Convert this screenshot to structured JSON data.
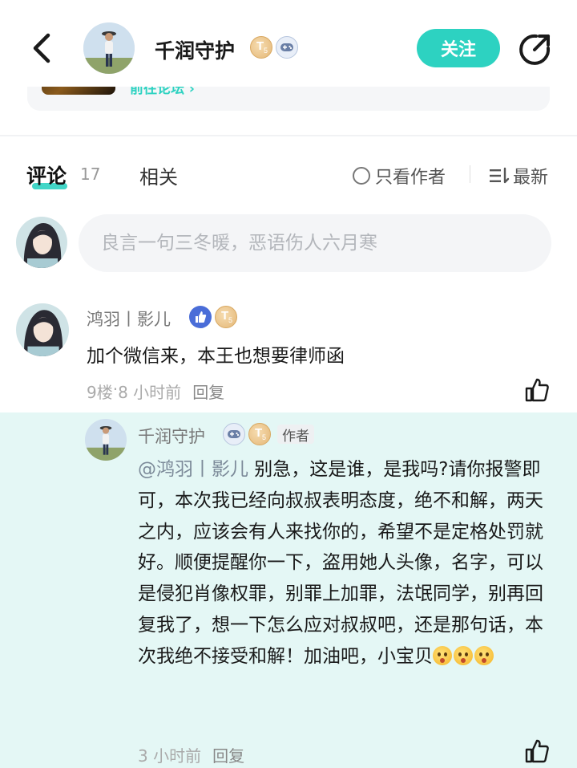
{
  "header": {
    "user_name": "千润守护",
    "follow_label": "关注",
    "coin_badge_letter": "T",
    "coin_badge_sub": "5",
    "forum_link_text": "前往论坛 ›"
  },
  "tabs": {
    "comments_label": "评论",
    "comments_count": "17",
    "related_label": "相关",
    "only_author_label": "只看作者",
    "sort_label": "最新"
  },
  "comment_input": {
    "placeholder": "良言一句三冬暖，恶语伤人六月寒"
  },
  "comment": {
    "user_name": "鸿羽丨影儿",
    "text": "加个微信来，本王也想要律师函",
    "floor": "9楼",
    "dot": " · ",
    "time": "8 小时前",
    "reply_label": "回复"
  },
  "reply": {
    "user_name": "千润守护",
    "author_tag": "作者",
    "mention": "@鸿羽丨影儿",
    "text": " 别急，这是谁，是我吗?请你报警即可，本次我已经向叔叔表明态度，绝不和解，两天之内，应该会有人来找你的，希望不是定格处罚就好。顺便提醒你一下，盗用她人头像，名字，可以是侵犯肖像权罪，别罪上加罪，法氓同学，别再回复我了，想一下怎么应对叔叔吧，还是那句话，本次我绝不接受和解！加油吧，小宝贝",
    "emoji_name": "astonished-face-emoji",
    "time": "3 小时前",
    "reply_label": "回复"
  },
  "colors": {
    "accent": "#2dd2c1",
    "reply_bg": "#e4f7f5",
    "muted_text": "#aaaaaa"
  }
}
